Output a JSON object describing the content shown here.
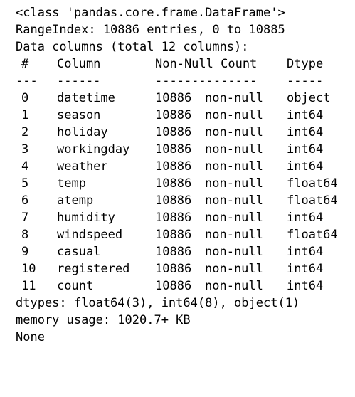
{
  "header": {
    "class_line": "<class 'pandas.core.frame.DataFrame'>",
    "range_index": "RangeIndex: 10886 entries, 0 to 10885",
    "data_columns": "Data columns (total 12 columns):"
  },
  "table": {
    "headers": {
      "idx": "#",
      "column": "Column",
      "count": "Non-Null Count",
      "dtype": "Dtype"
    },
    "separators": {
      "idx": "---",
      "column": "------",
      "count": "--------------",
      "dtype": "-----"
    },
    "rows": [
      {
        "idx": "0",
        "column": "datetime",
        "count": "10886",
        "nonnull": "non-null",
        "dtype": "object"
      },
      {
        "idx": "1",
        "column": "season",
        "count": "10886",
        "nonnull": "non-null",
        "dtype": "int64"
      },
      {
        "idx": "2",
        "column": "holiday",
        "count": "10886",
        "nonnull": "non-null",
        "dtype": "int64"
      },
      {
        "idx": "3",
        "column": "workingday",
        "count": "10886",
        "nonnull": "non-null",
        "dtype": "int64"
      },
      {
        "idx": "4",
        "column": "weather",
        "count": "10886",
        "nonnull": "non-null",
        "dtype": "int64"
      },
      {
        "idx": "5",
        "column": "temp",
        "count": "10886",
        "nonnull": "non-null",
        "dtype": "float64"
      },
      {
        "idx": "6",
        "column": "atemp",
        "count": "10886",
        "nonnull": "non-null",
        "dtype": "float64"
      },
      {
        "idx": "7",
        "column": "humidity",
        "count": "10886",
        "nonnull": "non-null",
        "dtype": "int64"
      },
      {
        "idx": "8",
        "column": "windspeed",
        "count": "10886",
        "nonnull": "non-null",
        "dtype": "float64"
      },
      {
        "idx": "9",
        "column": "casual",
        "count": "10886",
        "nonnull": "non-null",
        "dtype": "int64"
      },
      {
        "idx": "10",
        "column": "registered",
        "count": "10886",
        "nonnull": "non-null",
        "dtype": "int64"
      },
      {
        "idx": "11",
        "column": "count",
        "count": "10886",
        "nonnull": "non-null",
        "dtype": "int64"
      }
    ]
  },
  "footer": {
    "dtypes": "dtypes: float64(3), int64(8), object(1)",
    "memory": "memory usage: 1020.7+ KB",
    "none": "None"
  }
}
